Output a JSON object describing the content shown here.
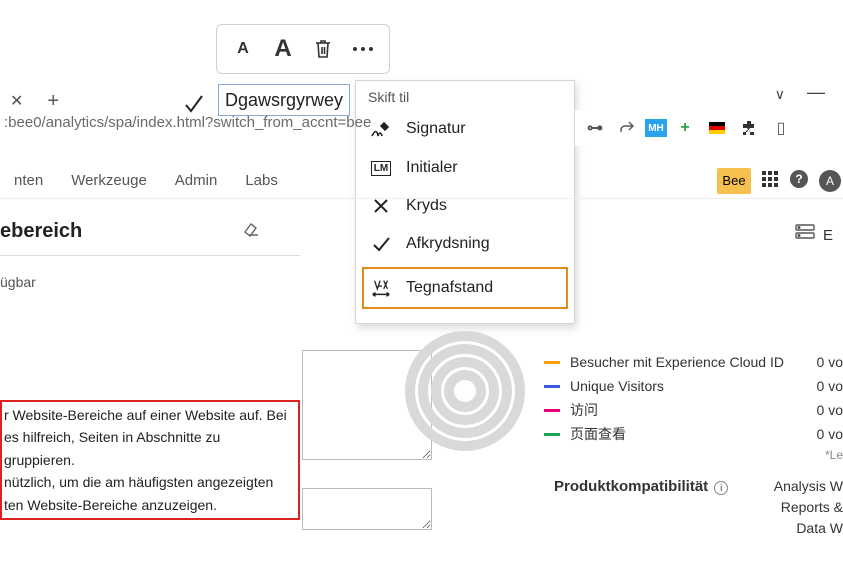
{
  "toolbar": {
    "small_a": "A",
    "large_a": "A"
  },
  "input": {
    "value": "Dgawsrgyrwey"
  },
  "menu": {
    "title": "Skift til",
    "items": [
      {
        "label": "Signatur"
      },
      {
        "label": "Initialer"
      },
      {
        "label": "Kryds"
      },
      {
        "label": "Afkrydsning"
      },
      {
        "label": "Tegnafstand"
      }
    ]
  },
  "url": ":bee0/analytics/spa/index.html?switch_from_accnt=bee",
  "subnav": {
    "items": [
      "nten",
      "Werkzeuge",
      "Admin",
      "Labs"
    ],
    "badge": "Bee"
  },
  "panel": {
    "title": "ebereich",
    "status": "ügbar",
    "description_lines": [
      "r Website-Bereiche auf einer Website auf. Bei",
      "es hilfreich, Seiten in Abschnitte zu gruppieren.",
      " nützlich, um die am häufigsten angezeigten",
      "ten Website-Bereiche anzuzeigen."
    ]
  },
  "metrics": {
    "rows": [
      {
        "color": "#f59e0b",
        "label": "Besucher mit Experience Cloud ID",
        "value": "0 vo"
      },
      {
        "color": "#3b5bdb",
        "label": "Unique Visitors",
        "value": "0 vo"
      },
      {
        "color": "#e6007a",
        "label": "访问",
        "value": "0 vo"
      },
      {
        "color": "#18a558",
        "label": "页面查看",
        "value": "0 vo"
      }
    ],
    "note": "*Le"
  },
  "prodkomp": {
    "title": "Produktkompatibilität",
    "items": [
      "Analysis W",
      "Reports &",
      "Data W"
    ]
  },
  "chart_data": {
    "type": "pie",
    "title": "",
    "series": [
      {
        "name": "Besucher mit Experience Cloud ID",
        "value": 0,
        "color": "#f59e0b"
      },
      {
        "name": "Unique Visitors",
        "value": 0,
        "color": "#3b5bdb"
      },
      {
        "name": "访问",
        "value": 0,
        "color": "#e6007a"
      },
      {
        "name": "页面查看",
        "value": 0,
        "color": "#18a558"
      }
    ]
  }
}
